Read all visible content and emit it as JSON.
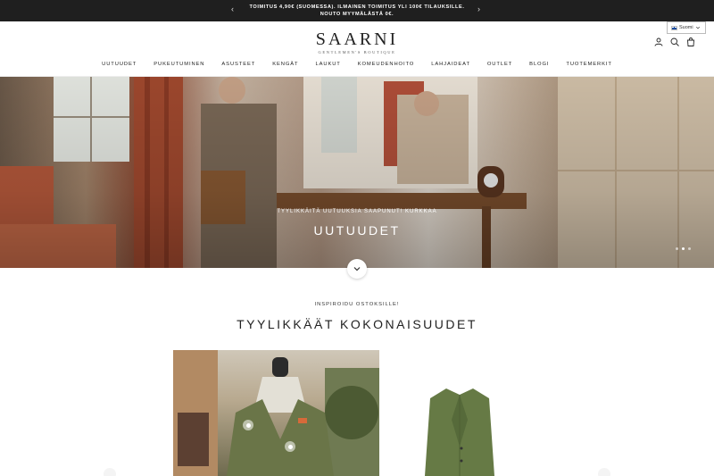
{
  "announcement": {
    "line1": "TOIMITUS 4,90€ (SUOMESSA). ILMAINEN TOIMITUS YLI 100€ TILAUKSILLE.",
    "line2": "NOUTO MYYMÄLÄSTÄ 0€.",
    "prev_icon": "‹",
    "next_icon": "›"
  },
  "language": {
    "label": "Suomi",
    "icon": "finnish-flag"
  },
  "logo": {
    "name": "SAARNI",
    "tagline": "GENTLEMEN'S BOUTIQUE"
  },
  "nav": [
    "UUTUUDET",
    "PUKEUTUMINEN",
    "ASUSTEET",
    "KENGÄT",
    "LAUKUT",
    "KOMEUDENHOITO",
    "LAHJAIDEAT",
    "OUTLET",
    "BLOGI",
    "TUOTEMERKIT"
  ],
  "hero": {
    "kicker": "TYYLIKKÄITÄ UUTUUKSIA SAAPUNUT! KURKKAA",
    "title": "UUTUUDET"
  },
  "section": {
    "kicker": "INSPIROIDU OSTOKSILLE!",
    "title": "TYYLIKKÄÄT KOKONAISUUDET"
  },
  "icons": [
    "account-icon",
    "search-icon",
    "cart-icon",
    "chevron-down-icon"
  ]
}
